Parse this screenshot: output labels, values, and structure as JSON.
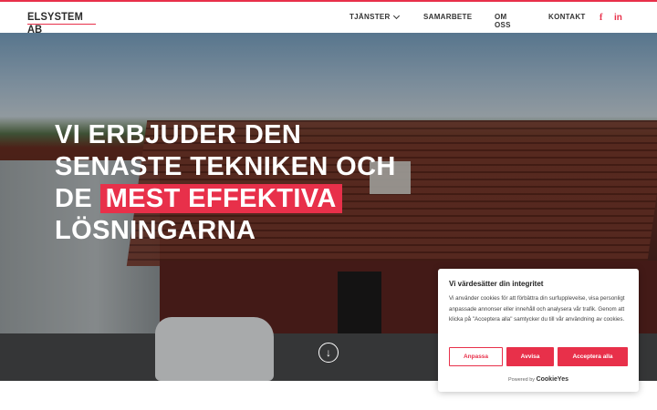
{
  "header": {
    "logo_text": "ELSYSTEM AB",
    "nav": [
      {
        "label": "TJÄNSTER"
      },
      {
        "label": "SAMARBETE"
      },
      {
        "label": "OM OSS"
      },
      {
        "label": "KONTAKT"
      }
    ],
    "social": {
      "facebook": "f",
      "linkedin": "in"
    }
  },
  "hero": {
    "line1": "VI ERBJUDER DEN",
    "line2": "SENASTE TEKNIKEN OCH",
    "line3_prefix": "DE",
    "line3_highlight": "MEST EFFEKTIVA",
    "line4": "LÖSNINGARNA",
    "scroll_glyph": "↓"
  },
  "cookie": {
    "title": "Vi värdesätter din integritet",
    "text": "Vi använder cookies för att förbättra din surfupplevelse, visa personligt anpassade annonser eller innehåll och analysera vår trafik. Genom att klicka på \"Acceptera alla\" samtycker du till vår användning av cookies.",
    "btn_customize": "Anpassa",
    "btn_reject": "Avvisa",
    "btn_accept": "Acceptera alla",
    "powered_prefix": "Powered by",
    "powered_brand": "CookieYes"
  },
  "colors": {
    "accent": "#e8304a",
    "text_dark": "#333333"
  }
}
